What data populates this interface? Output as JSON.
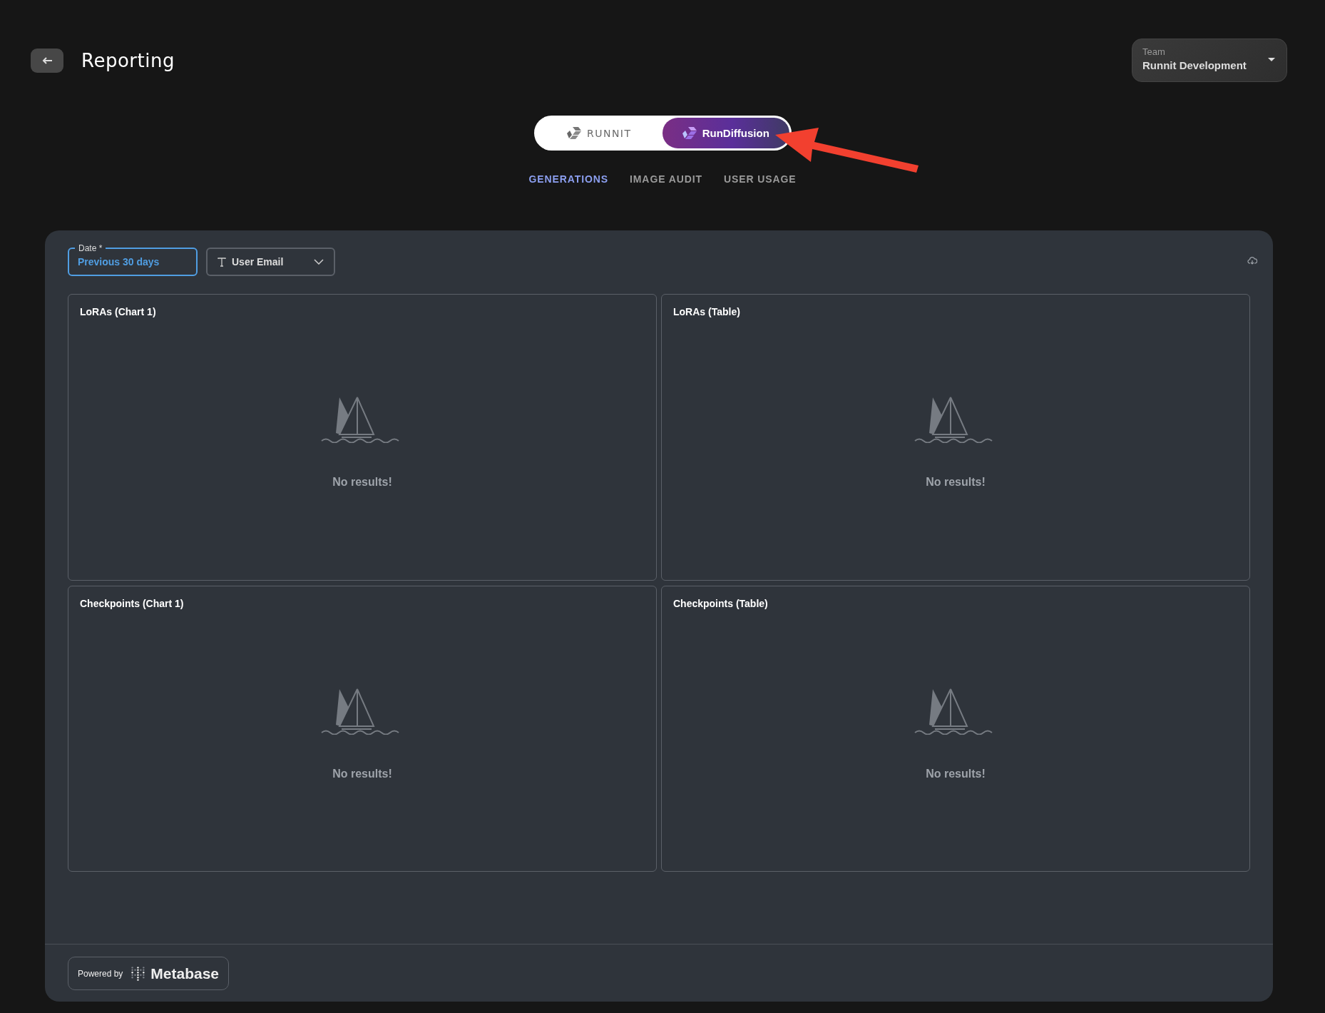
{
  "header": {
    "title": "Reporting"
  },
  "team_select": {
    "label": "Team",
    "value": "Runnit Development"
  },
  "product_switch": [
    {
      "label": "RUNNIT",
      "selected": false
    },
    {
      "label": "RunDiffusion",
      "selected": true
    }
  ],
  "tabs": [
    {
      "label": "GENERATIONS",
      "selected": true
    },
    {
      "label": "IMAGE AUDIT",
      "selected": false
    },
    {
      "label": "USER USAGE",
      "selected": false
    }
  ],
  "filters": [
    {
      "kind": "date",
      "label": "Date *",
      "value": "Previous 30 days"
    },
    {
      "kind": "text",
      "label": "User Email"
    }
  ],
  "cards": [
    {
      "title": "LoRAs (Chart 1)",
      "message": "No results!"
    },
    {
      "title": "LoRAs (Table)",
      "message": "No results!"
    },
    {
      "title": "Checkpoints (Chart 1)",
      "message": "No results!"
    },
    {
      "title": "Checkpoints (Table)",
      "message": "No results!"
    }
  ],
  "footer": {
    "powered_by": "Powered by",
    "brand": "Metabase"
  }
}
